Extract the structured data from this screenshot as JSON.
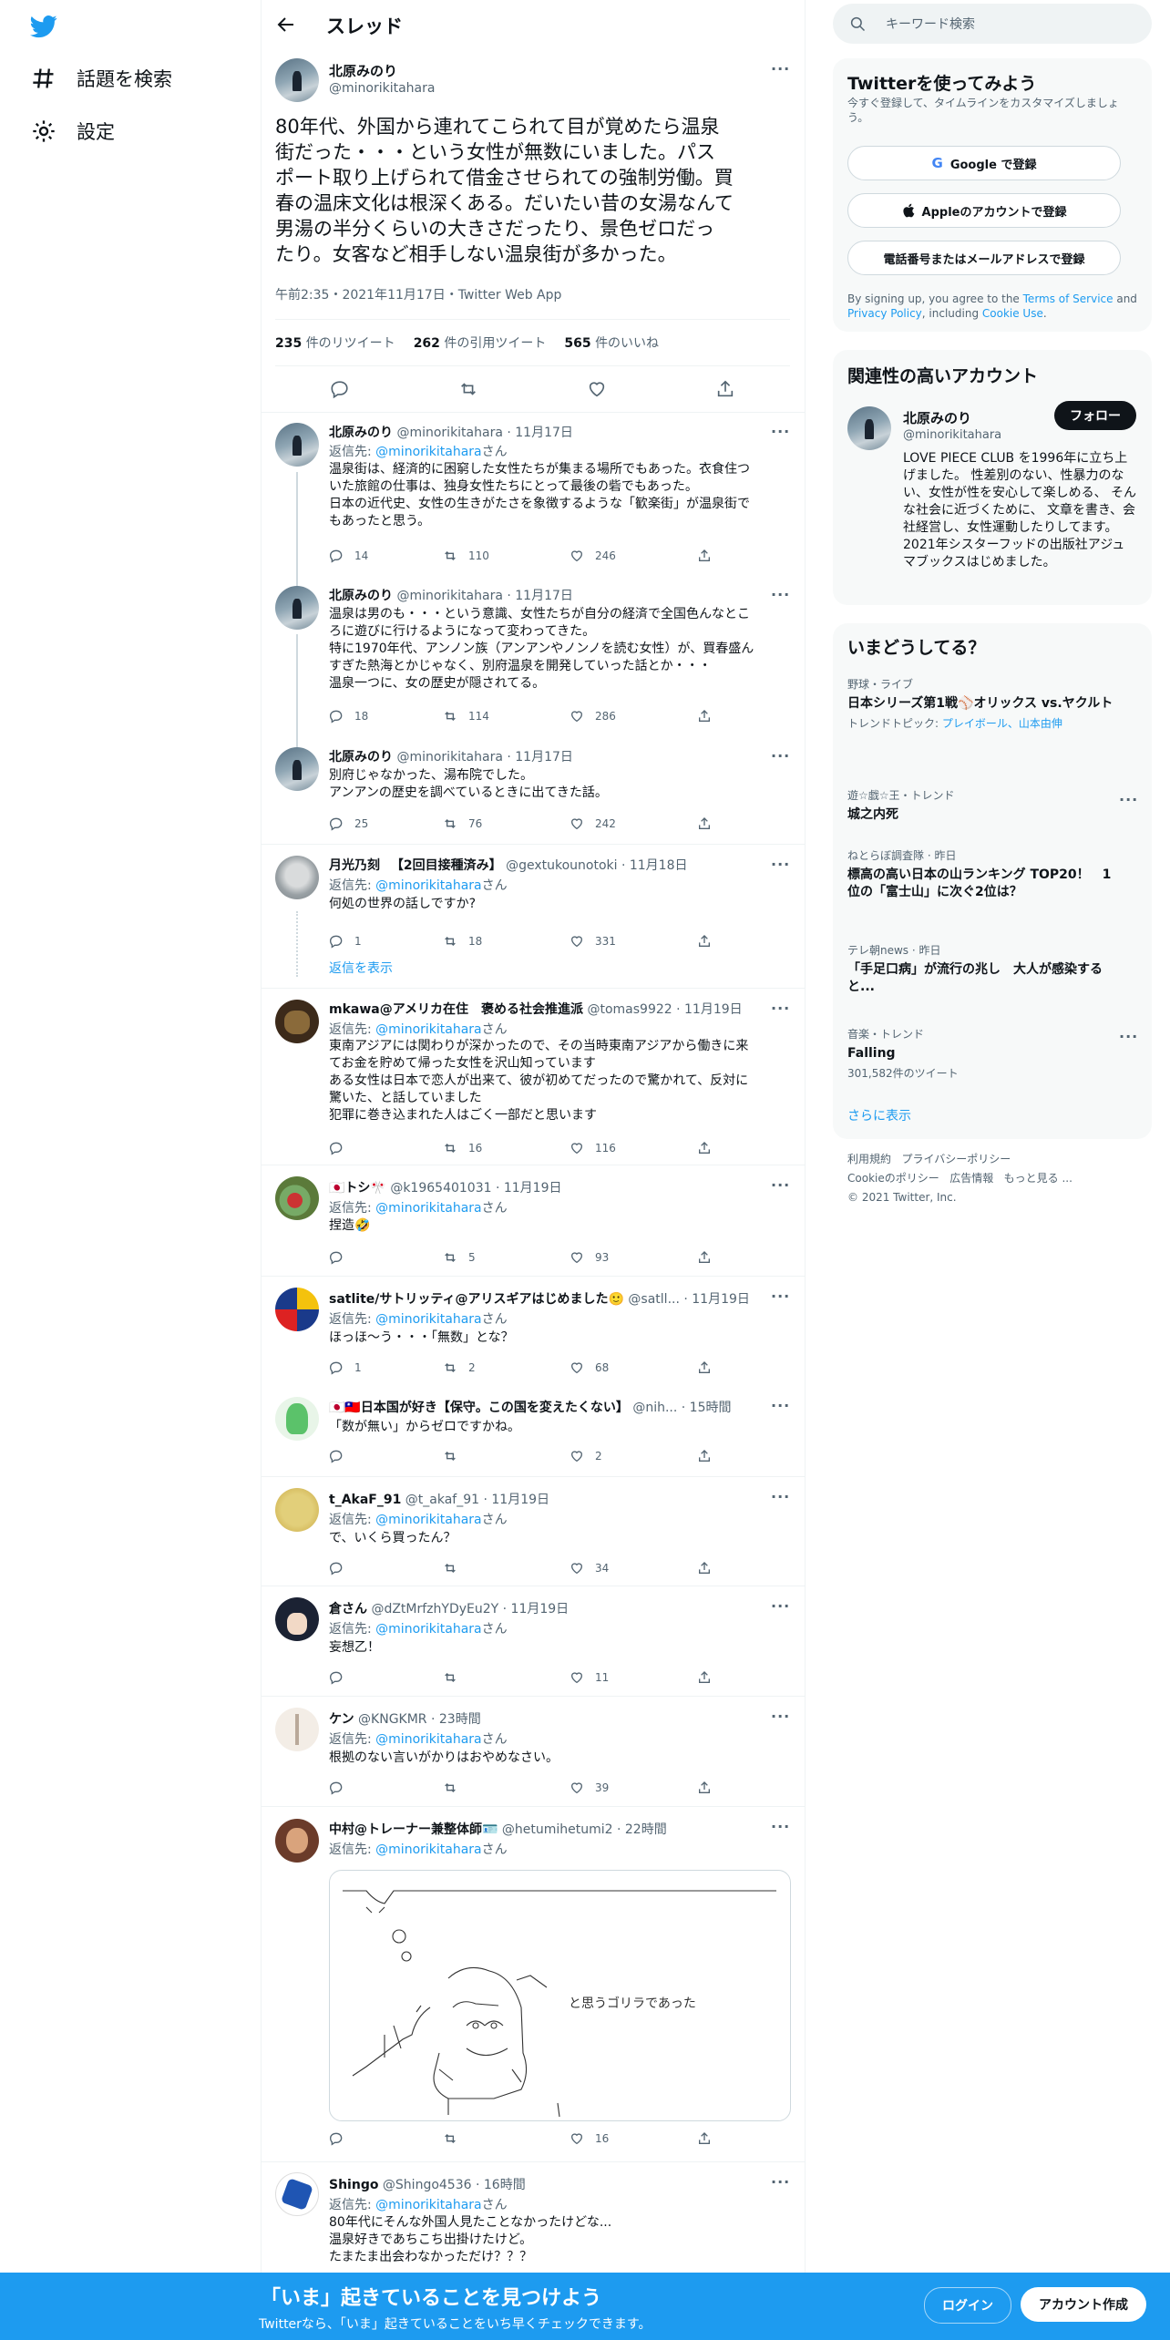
{
  "nav": {
    "explore_label": "話題を検索",
    "settings_label": "設定"
  },
  "header": {
    "title": "スレッド"
  },
  "main_tweet": {
    "name": "北原みのり",
    "handle": "@minorikitahara",
    "text": "80年代、外国から連れてこられて目が覚めたら温泉\n街だった・・・という女性が無数にいました。パス\nポート取り上げられて借金させられての強制労働。買\n春の温床文化は根深くある。だいたい昔の女湯なんて\n男湯の半分くらいの大きさだったり、景色ゼロだっ\nたり。女客など相手しない温泉街が多かった。",
    "meta": "午前2:35・2021年11月17日・Twitter Web App",
    "retweets_count": "235",
    "retweets_label": "件のリツイート",
    "quotes_count": "262",
    "quotes_label": "件の引用ツイート",
    "likes_count": "565",
    "likes_label": "件のいいね"
  },
  "replies": [
    {
      "name": "北原みのり",
      "handle": "@minorikitahara · 11月17日",
      "reply_to": "@minorikitahara",
      "text": "温泉街は、経済的に困窮した女性たちが集まる場所でもあった。衣食住つ\nいた旅館の仕事は、独身女性たちにとって最後の砦でもあった。\n日本の近代史、女性の生きがたさを象徴するような「歓楽街」が温泉街で\nもあったと思う。",
      "reply_count": "14",
      "retweet_count": "110",
      "like_count": "246"
    },
    {
      "name": "北原みのり",
      "handle": "@minorikitahara · 11月17日",
      "text": "温泉は男のも・・・という意識、女性たちが自分の経済で全国色んなとこ\nろに遊びに行けるようになって変わってきた。\n特に1970年代、アンノン族（アンアンやノンノを読む女性）が、買春盛ん\nすぎた熱海とかじゃなく、別府温泉を開発していった話とか・・・\n温泉一つに、女の歴史が隠されてる。",
      "reply_count": "18",
      "retweet_count": "114",
      "like_count": "286"
    },
    {
      "name": "北原みのり",
      "handle": "@minorikitahara · 11月17日",
      "text": "別府じゃなかった、湯布院でした。\nアンアンの歴史を調べているときに出てきた話。",
      "reply_count": "25",
      "retweet_count": "76",
      "like_count": "242"
    },
    {
      "name": "月光乃刻 　【2回目接種済み】",
      "handle": "@gextukounotoki · 11月18日",
      "reply_to": "@minorikitahara",
      "text": "何処の世界の話しですか?",
      "reply_count": "1",
      "retweet_count": "18",
      "like_count": "331",
      "show_replies": "返信を表示"
    },
    {
      "name": "mkawa@アメリカ在住　褒める社会推進派",
      "handle": "@tomas9922 · 11月19日",
      "reply_to": "@minorikitahara",
      "text": "東南アジアには関わりが深かったので、その当時東南アジアから働きに来\nてお金を貯めて帰った女性を沢山知っています\nある女性は日本で恋人が出来て、彼が初めてだったので驚かれて、反対に\n驚いた、と話していました\n犯罪に巻き込まれた人はごく一部だと思います",
      "reply_count": "",
      "retweet_count": "16",
      "like_count": "116"
    },
    {
      "name": "🇯🇵トシ🎌",
      "handle": "@k1965401031 · 11月19日",
      "reply_to": "@minorikitahara",
      "text": "捏造🤣",
      "reply_count": "",
      "retweet_count": "5",
      "like_count": "93"
    },
    {
      "name": "satlite/サトリッティ@アリスギアはじめました🙂",
      "handle": "@satll... · 11月19日",
      "reply_to": "@minorikitahara",
      "text": "ほっほ～う・・・「無数」とな？",
      "reply_count": "1",
      "retweet_count": "2",
      "like_count": "68"
    },
    {
      "name": "🇯🇵🇹🇼日本国が好き【保守。この国を変えたくない】",
      "handle": "@nih... · 15時間",
      "text": "「数が無い」からゼロですかね。",
      "reply_count": "",
      "retweet_count": "",
      "like_count": "2"
    },
    {
      "name": "t_AkaF_91",
      "handle": "@t_akaf_91 · 11月19日",
      "reply_to": "@minorikitahara",
      "text": "で、いくら買ったん？",
      "reply_count": "",
      "retweet_count": "",
      "like_count": "34"
    },
    {
      "name": "倉さん",
      "handle": "@dZtMrfzhYDyEu2Y · 11月19日",
      "reply_to": "@minorikitahara",
      "text": "妄想乙！",
      "reply_count": "",
      "retweet_count": "",
      "like_count": "11"
    },
    {
      "name": "ケン",
      "handle": "@KNGKMR · 23時間",
      "reply_to": "@minorikitahara",
      "text": "根拠のない言いがかりはおやめなさい。",
      "reply_count": "",
      "retweet_count": "",
      "like_count": "39"
    },
    {
      "name": "中村@トレーナー兼整体師🪪",
      "handle": "@hetumihetumi2 · 22時間",
      "reply_to": "@minorikitahara",
      "text": "",
      "aa_caption": "と思うゴリラであった",
      "reply_count": "",
      "retweet_count": "",
      "like_count": "16"
    },
    {
      "name": "Shingo",
      "handle": "@Shingo4536 · 16時間",
      "reply_to": "@minorikitahara",
      "text": "80年代にそんな外国人見たことなかったけどな...\n温泉好きであちこち出掛けたけど。\nたまたま出会わなかっただけ？？？"
    }
  ],
  "reply_prefix": "返信先: ",
  "reply_suffix": "さん",
  "search": {
    "placeholder": "キーワード検索"
  },
  "signup": {
    "title": "Twitterを使ってみよう",
    "subtitle": "今すぐ登録して、タイムラインをカスタマイズしましょう。",
    "google": "Google で登録",
    "apple": "Appleのアカウントで登録",
    "phone": "電話番号またはメールアドレスで登録",
    "terms_prefix": "By signing up, you agree to the ",
    "terms_link": "Terms of Service",
    "terms_and": " and ",
    "privacy_link": "Privacy Policy",
    "terms_including": ", including ",
    "cookie_link": "Cookie Use",
    "terms_end": "."
  },
  "related": {
    "title": "関連性の高いアカウント",
    "name": "北原みのり",
    "handle": "@minorikitahara",
    "follow": "フォロー",
    "bio": "LOVE PIECE CLUB を1996年に立ち上げました。 性差別のない、性暴力のない、女性が性を安心して楽しめる、 そんな社会に近づくために、 文章を書き、会社経営し、女性運動したりしてます。2021年シスターフッドの出版社アジュマブックスはじめました。"
  },
  "trends": {
    "title": "いまどうしてる？",
    "items": [
      {
        "category": "野球・ライブ",
        "title": "日本シリーズ第1戦⚾オリックス vs.ヤクルト",
        "sub_prefix": "トレンドトピック: ",
        "sub_link": "プレイボール、山本由伸"
      },
      {
        "category": "遊☆戯☆王・トレンド",
        "title": "城之内死"
      },
      {
        "category": "ねとらぼ調査隊 · 昨日",
        "title": "標高の高い日本の山ランキング TOP20！　1位の「富士山」に次ぐ2位は？"
      },
      {
        "category": "テレ朝news · 昨日",
        "title": "「手足口病」が流行の兆し　大人が感染すると..."
      },
      {
        "category": "音楽・トレンド",
        "title": "Falling",
        "sub": "301,582件のツイート"
      }
    ],
    "show_more": "さらに表示"
  },
  "footer": {
    "terms": "利用規約",
    "privacy": "プライバシーポリシー",
    "cookie": "Cookieのポリシー",
    "ads": "広告情報",
    "more": "もっと見る ...",
    "copyright": "© 2021 Twitter, Inc."
  },
  "bottombar": {
    "title": "「いま」起きていることを見つけよう",
    "subtitle": "Twitterなら、「いま」起きていることをいち早くチェックできます。",
    "login": "ログイン",
    "signup": "アカウント作成"
  },
  "colors": {
    "accent": "#1d9bf0",
    "text": "#0f1419",
    "muted": "#536471",
    "border": "#eff3f4"
  }
}
